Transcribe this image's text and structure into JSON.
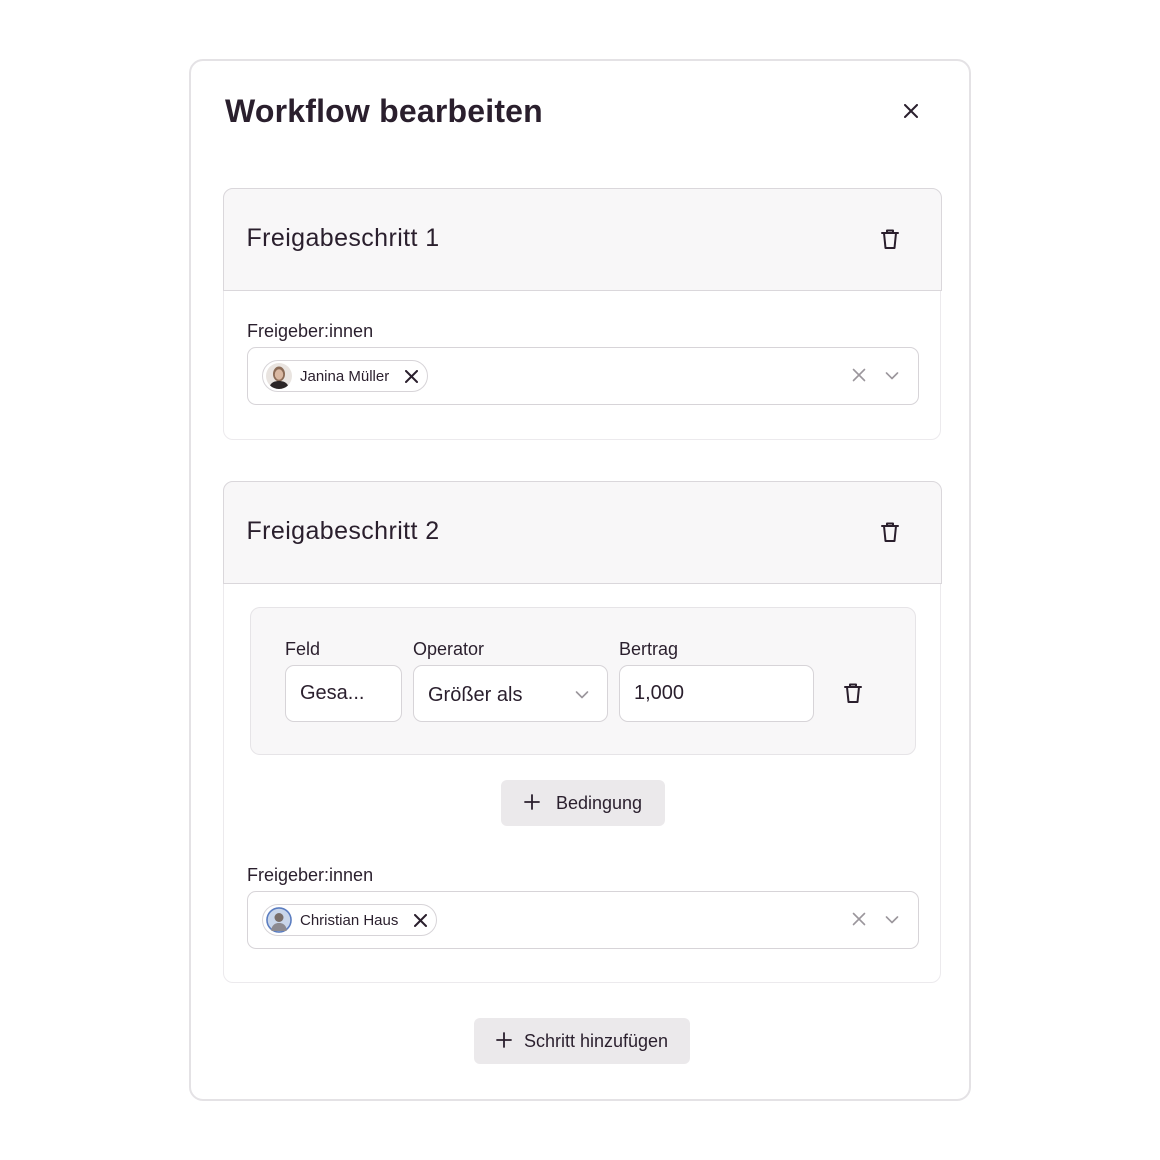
{
  "modal": {
    "title": "Workflow bearbeiten"
  },
  "steps": [
    {
      "title": "Freigabeschritt 1",
      "approvers_label": "Freigeber:innen",
      "approvers": [
        {
          "name": "Janina Müller"
        }
      ]
    },
    {
      "title": "Freigabeschritt 2",
      "condition": {
        "field_label": "Feld",
        "field_value": "Gesa...",
        "operator_label": "Operator",
        "operator_value": "Größer als",
        "amount_label": "Bertrag",
        "amount_value": "1,000"
      },
      "add_condition_label": "Bedingung",
      "approvers_label": "Freigeber:innen",
      "approvers": [
        {
          "name": "Christian Haus"
        }
      ]
    }
  ],
  "add_step_label": "Schritt hinzufügen",
  "icons": {
    "close": "close-icon",
    "delete": "trash-icon",
    "clear": "clear-icon",
    "dropdown": "chevron-down-icon",
    "add": "plus-icon"
  },
  "colors": {
    "text": "#2a1f2d",
    "header_bg": "#f8f7f8",
    "button_bg": "#ebe9eb",
    "border": "#d7d4d8"
  }
}
